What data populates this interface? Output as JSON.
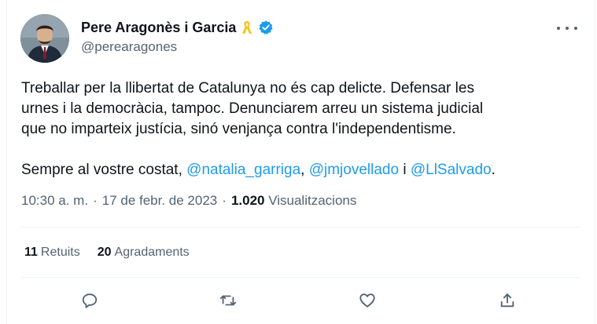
{
  "author": {
    "name": "Pere Aragonès i Garcia",
    "handle": "@perearagones"
  },
  "tweet": {
    "line1": "Treballar per la llibertat de Catalunya no és cap delicte. Defensar les",
    "line2": "urnes i la democràcia, tampoc. Denunciarem arreu un sistema judicial",
    "line3": "que no imparteix justícia, sinó venjança contra l'independentisme.",
    "p2_prefix": "Sempre al vostre costat, ",
    "mention1": "@natalia_garriga",
    "sep1": ", ",
    "mention2": "@jmjovellado",
    "sep2": " i ",
    "mention3": "@LlSalvado",
    "p2_suffix": "."
  },
  "meta": {
    "time": "10:30 a. m.",
    "dot1": "·",
    "date": "17 de febr. de 2023",
    "dot2": "·",
    "views_count": "1.020",
    "views_label": "Visualitzacions"
  },
  "stats": {
    "retweets_count": "11",
    "retweets_label": "Retuits",
    "likes_count": "20",
    "likes_label": "Agradaments"
  },
  "icons": {
    "ribbon": "yellow-ribbon-icon",
    "verified": "verified-badge-icon",
    "more": "more-options-icon",
    "reply": "reply-icon",
    "retweet": "retweet-icon",
    "like": "heart-icon",
    "share": "share-icon"
  },
  "colors": {
    "accent": "#1d9bf0",
    "ribbon": "#f5c518",
    "muted": "#536471"
  }
}
